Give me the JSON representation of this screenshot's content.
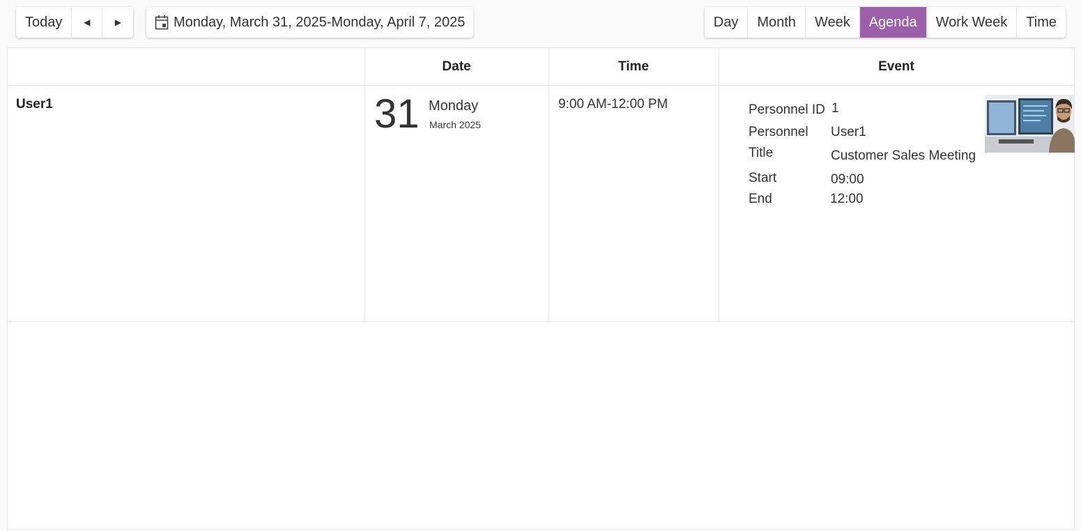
{
  "toolbar": {
    "today_label": "Today",
    "prev_icon": "caret-left-icon",
    "next_icon": "caret-right-icon",
    "calendar_icon": "calendar-icon",
    "date_range": "Monday, March 31, 2025-Monday, April 7, 2025",
    "views": [
      "Day",
      "Month",
      "Week",
      "Agenda",
      "Work Week",
      "Time"
    ],
    "active_view": "Agenda",
    "accent_color": "#9c60ab"
  },
  "columns": {
    "date": "Date",
    "time": "Time",
    "event": "Event"
  },
  "row": {
    "user": "User1",
    "day_number": "31",
    "weekday": "Monday",
    "month_year": "March 2025",
    "time_range": "9:00 AM-12:00 PM",
    "event": {
      "fields": [
        {
          "label": "Personnel ID",
          "value": "1"
        },
        {
          "label": "Personnel",
          "value": "User1"
        },
        {
          "label": "Title",
          "value": "Customer Sales Meeting"
        },
        {
          "label": "Start",
          "value": "09:00"
        },
        {
          "label": "End",
          "value": "12:00"
        }
      ],
      "photo_icon": "person-at-computer-photo"
    }
  }
}
